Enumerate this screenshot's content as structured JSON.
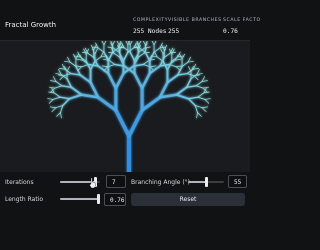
{
  "header": {
    "title": "Fractal Growth",
    "stats": [
      {
        "label": "COMPLEXITY",
        "value": "255 Nodes"
      },
      {
        "label": "VISIBLE BRANCHES",
        "value": "255"
      },
      {
        "label": "SCALE FACTO",
        "value": "0.76"
      }
    ]
  },
  "canvas": {
    "trunk_color": "#2f8fe6",
    "leaf_color": "#8fe3e0",
    "iterations": 7,
    "angle_deg": 27,
    "length_ratio": 0.76
  },
  "controls": {
    "iterations": {
      "label": "Iterations",
      "value": "7",
      "fraction": 0.88
    },
    "branching_angle": {
      "label": "Branching Angle (°)",
      "value": "55",
      "fraction": 0.5
    },
    "length_ratio": {
      "label": "Length Ratio",
      "value": "0.76",
      "fraction": 0.95
    },
    "reset_label": "Reset"
  },
  "icons": {
    "root_marker": "root-node-icon",
    "cursor": "cursor-pointer-icon"
  }
}
